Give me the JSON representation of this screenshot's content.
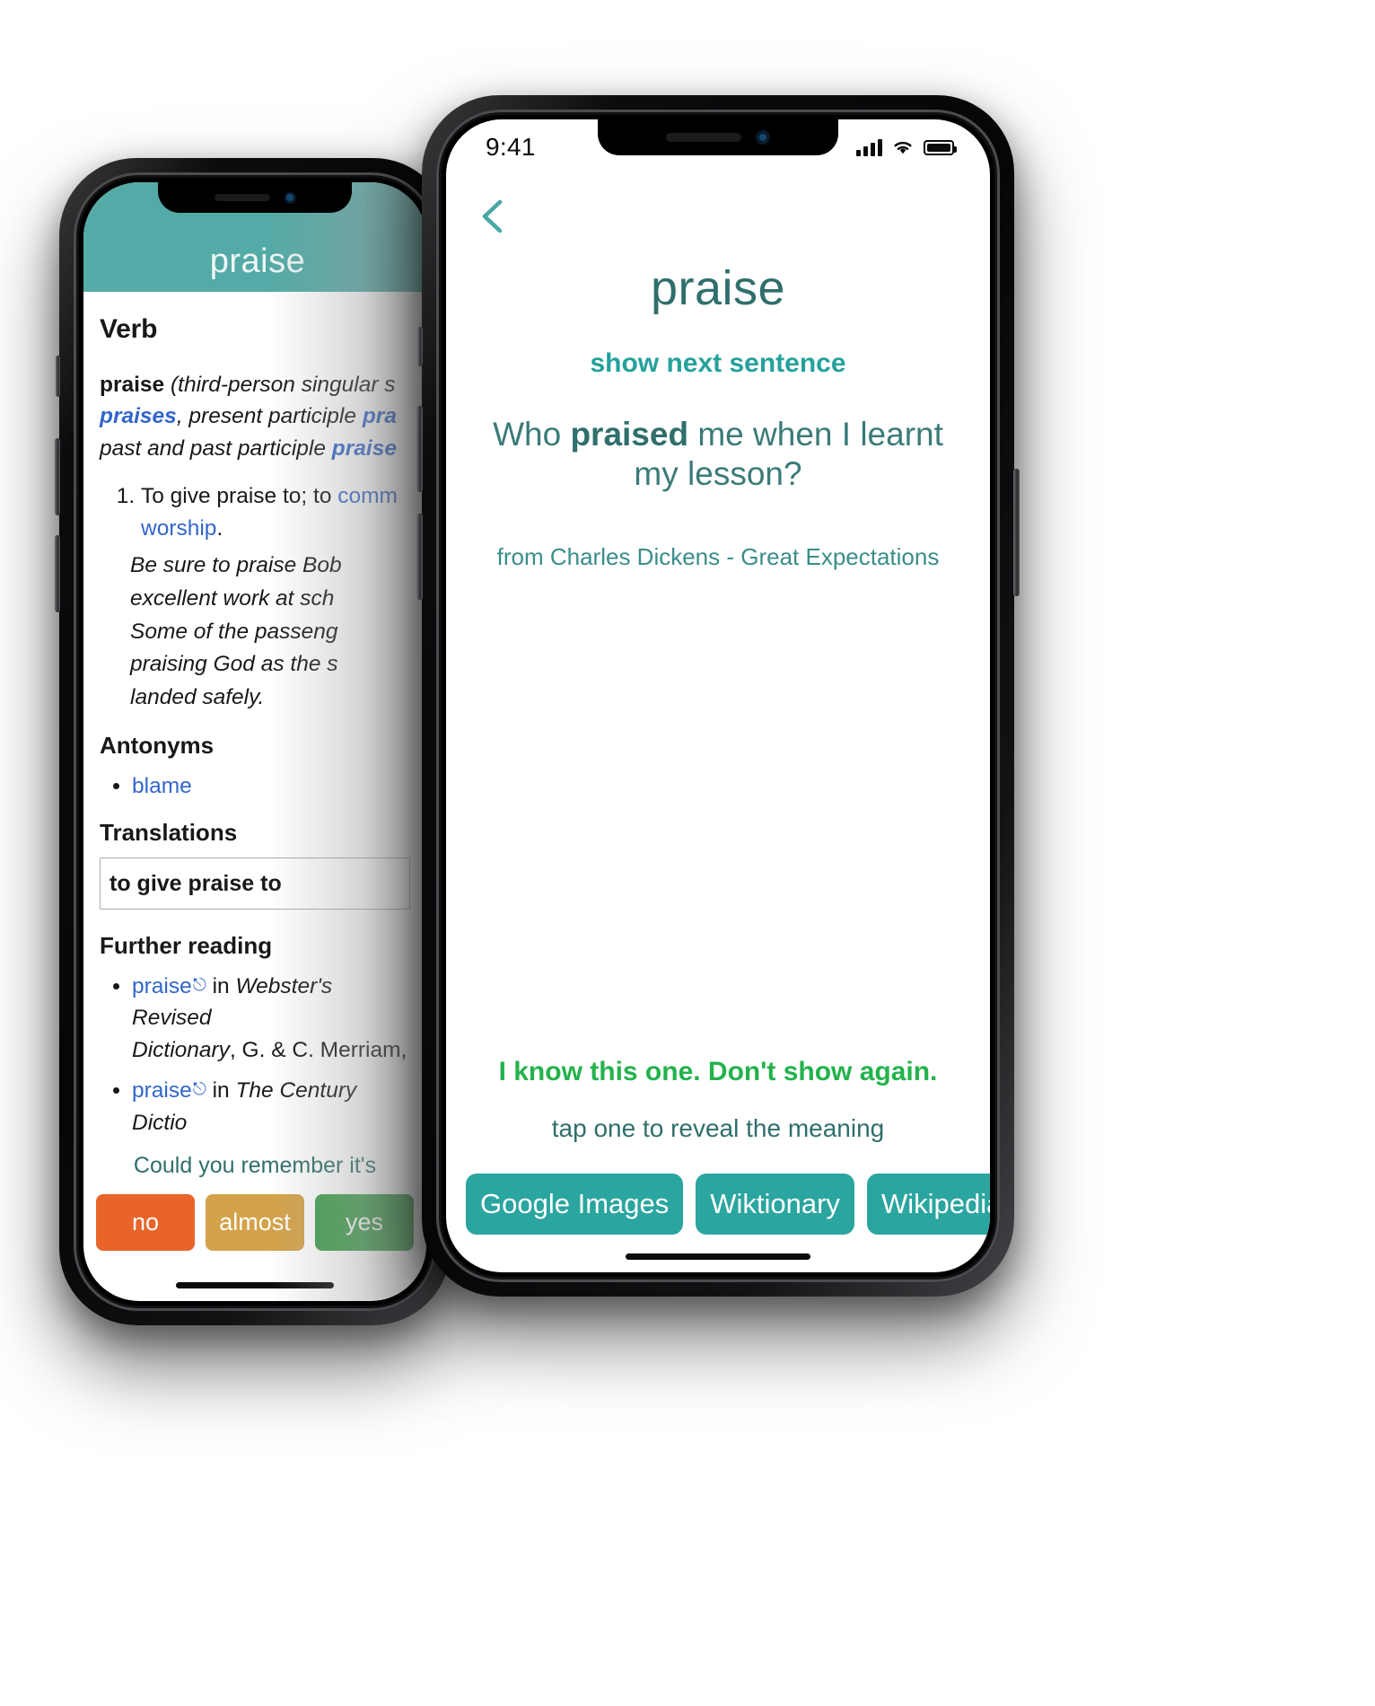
{
  "back_phone": {
    "header": {
      "word": "praise"
    },
    "dictionary": {
      "pos_heading": "Verb",
      "headword": "praise",
      "inflection_open": "(third-person singular s",
      "inflection_forms": "praises",
      "inflection_mid": ", present participle ",
      "inflection_form2": "pra",
      "inflection_line3": "past and past participle ",
      "inflection_form3": "praise",
      "definitions": [
        {
          "number": "1.",
          "text": "To give praise to; to ",
          "link1": "comm",
          "tail": "",
          "link2": "worship",
          "period": "."
        }
      ],
      "examples": [
        "Be sure to praise Bob",
        "excellent work at sch",
        "Some of the passeng",
        "praising God as the s",
        "landed safely."
      ],
      "antonyms_heading": "Antonyms",
      "antonyms": [
        "blame"
      ],
      "translations_heading": "Translations",
      "translation_value": "to give praise to",
      "further_reading_heading": "Further reading",
      "further_reading": [
        {
          "link": "praise",
          "in": "in",
          "source_italic": "Webster's Revised",
          "source_italic2": "Dictionary",
          "rest": ", G. & C. Merriam,"
        },
        {
          "link": "praise",
          "in": "in",
          "source_italic": "The Century Dictio",
          "source_italic2": "",
          "rest": ""
        }
      ],
      "remember_prompt": "Could you remember it's",
      "answer_buttons": [
        {
          "label": "no",
          "color": "#e8642a"
        },
        {
          "label": "almost",
          "color": "#d4a24a"
        },
        {
          "label": "yes",
          "color": "#3f9e4d"
        }
      ]
    }
  },
  "front_phone": {
    "status_bar": {
      "time": "9:41",
      "signal_icon": "cellular-bars-icon",
      "wifi_icon": "wifi-icon",
      "battery_icon": "battery-full-icon"
    },
    "nav": {
      "back_icon": "chevron-left-icon"
    },
    "flashcard": {
      "word": "praise",
      "next_sentence_label": "show next sentence",
      "sentence_prefix": "Who ",
      "sentence_highlight": "praised",
      "sentence_suffix": " me when I learnt my lesson?",
      "source": "from Charles Dickens - Great Expectations",
      "know_label": "I know this one. Don't show again.",
      "tap_hint": "tap one to reveal the meaning",
      "link_buttons": [
        "Google Images",
        "Wiktionary",
        "Wikipedia"
      ]
    }
  },
  "colors": {
    "teal_header": "#54aaa6",
    "teal_button": "#2ba5a0",
    "teal_text": "#2f6f6c",
    "teal_accent": "#25a19c",
    "green": "#24b24c",
    "link_blue": "#3366cc",
    "orange": "#e8642a",
    "gold": "#d4a24a"
  }
}
